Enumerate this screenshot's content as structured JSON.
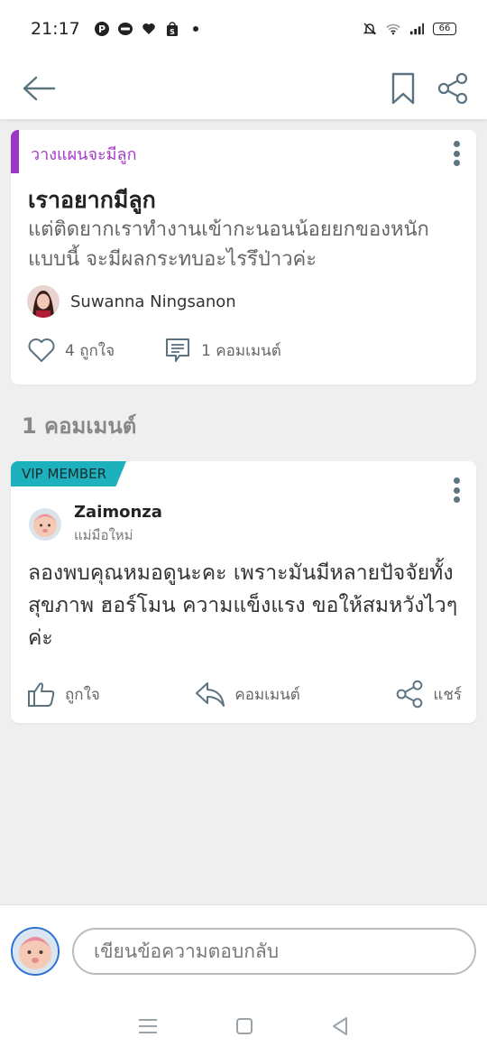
{
  "status_bar": {
    "time": "21:17",
    "battery": "66",
    "left_icons": [
      "pinterest-icon",
      "line-icon",
      "heart-icon",
      "shopee-icon",
      "dot-icon"
    ],
    "right_icons": [
      "mute-bell-icon",
      "wifi-icon",
      "signal-icon",
      "battery-icon"
    ]
  },
  "top_bar": {
    "back_icon": "arrow-left-icon",
    "bookmark_icon": "bookmark-icon",
    "share_icon": "share-icon"
  },
  "question": {
    "category": "วางแผนจะมีลูก",
    "title": "เราอยากมีลูก",
    "body": "แต่ติดยากเราทำงานเข้ากะนอนน้อยยกของหนักแบบนี้ จะมีผลกระทบอะไรรึป่าวค่ะ",
    "author": "Suwanna Ningsanon",
    "likes": "4 ถูกใจ",
    "comments": "1 คอมเมนต์"
  },
  "comments_heading": "1 คอมเมนต์",
  "comment": {
    "badge": "VIP MEMBER",
    "author": "Zaimonza",
    "role": "แม่มือใหม่",
    "body": "ลองพบคุณหมอดูนะคะ เพราะมันมีหลายปัจจัยทั้งสุขภาพ ฮอร์โมน ความแข็งแรง ขอให้สมหวังไวๆค่ะ",
    "like_label": "ถูกใจ",
    "reply_label": "คอมเมนต์",
    "share_label": "แชร์"
  },
  "reply_bar": {
    "placeholder": "เขียนข้อความตอบกลับ"
  },
  "colors": {
    "accent_purple": "#9b36c7",
    "vip_teal": "#1db1bd",
    "kebab": "#5d7480",
    "icon_blue_gray": "#5b7380"
  }
}
